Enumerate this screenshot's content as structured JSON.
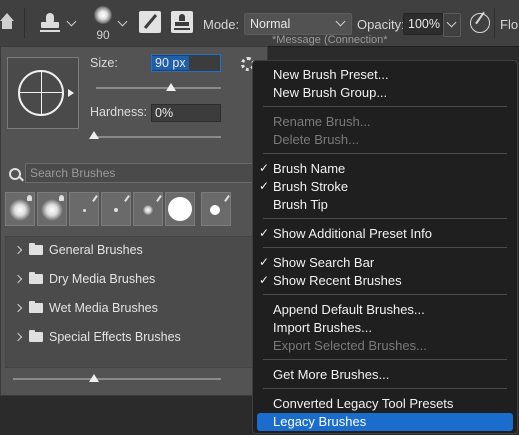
{
  "options_bar": {
    "brush_size": "90",
    "mode_label": "Mode:",
    "mode_value": "Normal",
    "opacity_label": "Opacity:",
    "opacity_value": "100%",
    "flow_label": "Flo",
    "background_message": "*Message (Connection*"
  },
  "brush_panel": {
    "size_label": "Size:",
    "size_value": "90 px",
    "hardness_label": "Hardness:",
    "hardness_value": "0%",
    "size_level": 0.6,
    "hardness_level": 0.0,
    "search_placeholder": "Search Brushes",
    "groups": [
      {
        "label": "General Brushes"
      },
      {
        "label": "Dry Media Brushes"
      },
      {
        "label": "Wet Media Brushes"
      },
      {
        "label": "Special Effects Brushes"
      }
    ]
  },
  "menu": {
    "items": [
      {
        "label": "New Brush Preset...",
        "enabled": true,
        "checked": false
      },
      {
        "label": "New Brush Group...",
        "enabled": true,
        "checked": false
      },
      {
        "label": "Rename Brush...",
        "enabled": false,
        "checked": false
      },
      {
        "label": "Delete Brush...",
        "enabled": false,
        "checked": false
      },
      {
        "label": "Brush Name",
        "enabled": true,
        "checked": true
      },
      {
        "label": "Brush Stroke",
        "enabled": true,
        "checked": true
      },
      {
        "label": "Brush Tip",
        "enabled": true,
        "checked": false
      },
      {
        "label": "Show Additional Preset Info",
        "enabled": true,
        "checked": true
      },
      {
        "label": "Show Search Bar",
        "enabled": true,
        "checked": true
      },
      {
        "label": "Show Recent Brushes",
        "enabled": true,
        "checked": true
      },
      {
        "label": "Append Default Brushes...",
        "enabled": true,
        "checked": false
      },
      {
        "label": "Import Brushes...",
        "enabled": true,
        "checked": false
      },
      {
        "label": "Export Selected Brushes...",
        "enabled": false,
        "checked": false
      },
      {
        "label": "Get More Brushes...",
        "enabled": true,
        "checked": false
      },
      {
        "label": "Converted Legacy Tool Presets",
        "enabled": true,
        "checked": false
      },
      {
        "label": "Legacy Brushes",
        "enabled": true,
        "checked": false,
        "selected": true
      }
    ],
    "check_glyph": "✓"
  }
}
